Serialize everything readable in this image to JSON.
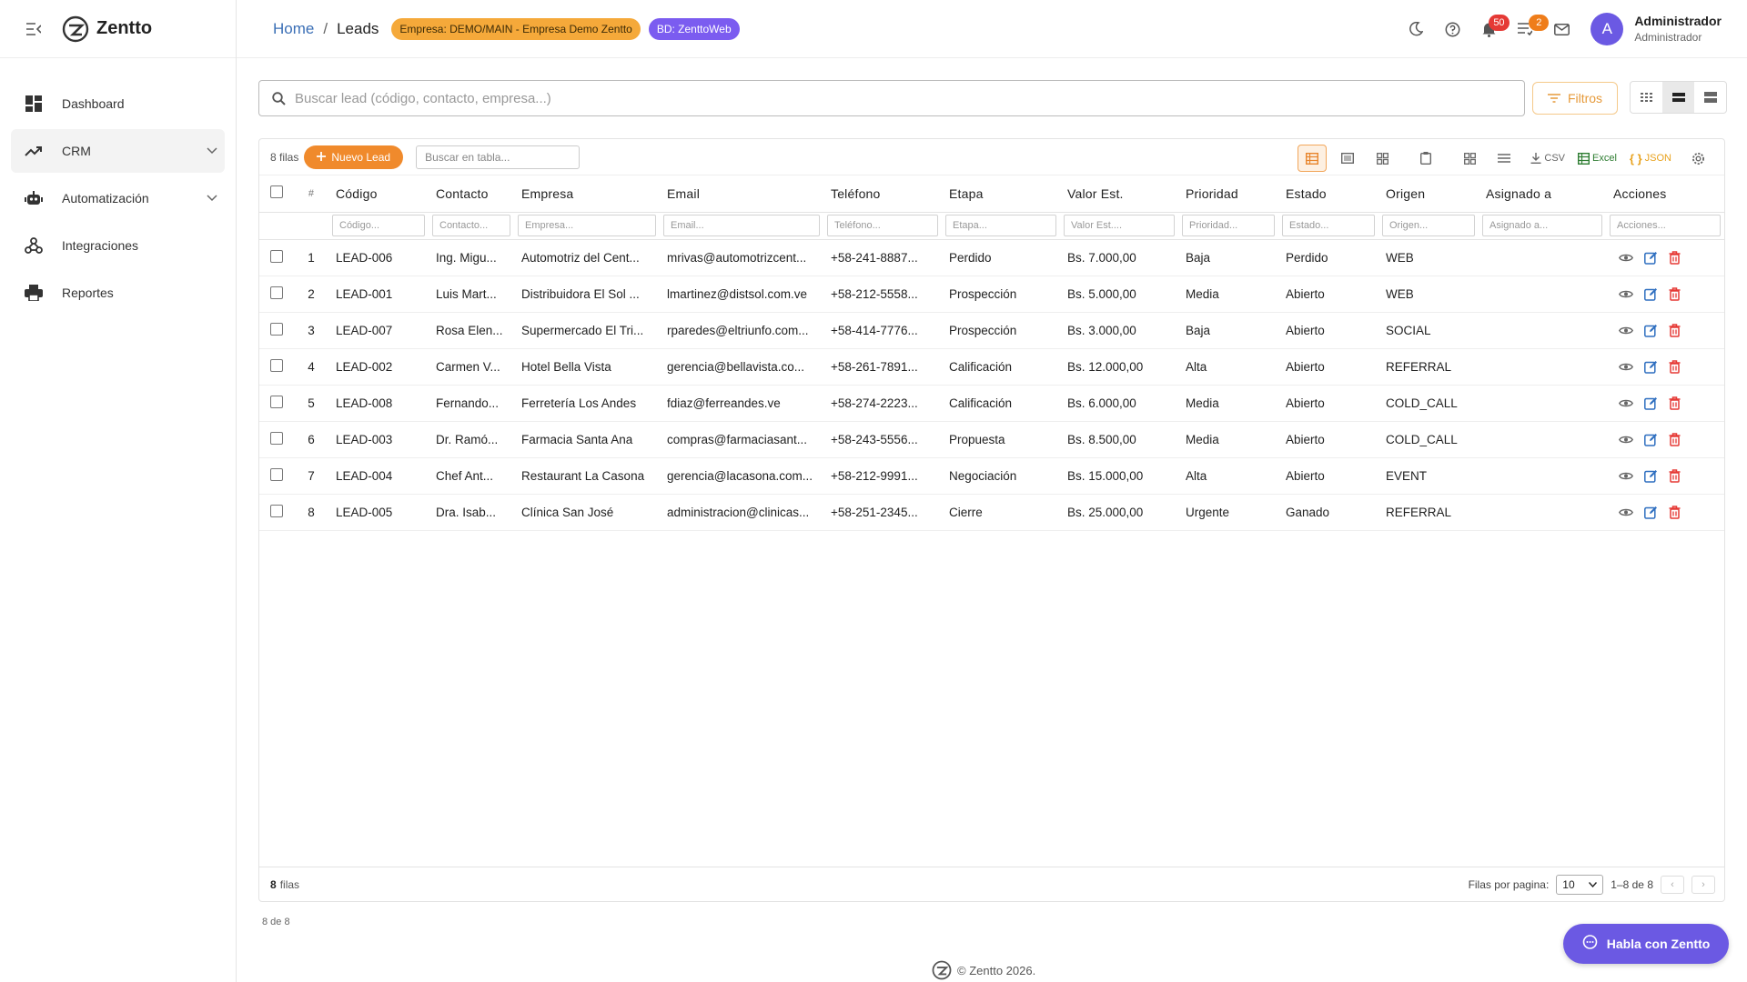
{
  "app": {
    "brand": "Zentto",
    "footer": "© Zentto 2026."
  },
  "sidebar": {
    "items": [
      {
        "label": "Dashboard",
        "icon": "dashboard-icon"
      },
      {
        "label": "CRM",
        "icon": "trending-up-icon",
        "active": true
      },
      {
        "label": "Automatización",
        "icon": "robot-icon"
      },
      {
        "label": "Integraciones",
        "icon": "webhook-icon"
      },
      {
        "label": "Reportes",
        "icon": "print-icon"
      }
    ]
  },
  "header": {
    "breadcrumb_home": "Home",
    "breadcrumb_sep": "/",
    "breadcrumb_current": "Leads",
    "company_badge": "Empresa: DEMO/MAIN - Empresa Demo Zentto",
    "db_badge": "BD: ZenttoWeb",
    "notifications_count": "50",
    "tasks_count": "2",
    "user_name": "Administrador",
    "user_role": "Administrador",
    "avatar_letter": "A"
  },
  "search": {
    "placeholder": "Buscar lead (código, contacto, empresa...)"
  },
  "filters_label": "Filtros",
  "grid": {
    "rows_label": "8 filas",
    "new_button": "Nuevo Lead",
    "table_search_placeholder": "Buscar en tabla...",
    "export_csv": "CSV",
    "export_excel": "Excel",
    "export_json": "JSON",
    "columns": [
      "#",
      "Código",
      "Contacto",
      "Empresa",
      "Email",
      "Teléfono",
      "Etapa",
      "Valor Est.",
      "Prioridad",
      "Estado",
      "Origen",
      "Asignado a",
      "Acciones"
    ],
    "filter_placeholders": [
      "Código...",
      "Contacto...",
      "Empresa...",
      "Email...",
      "Teléfono...",
      "Etapa...",
      "Valor Est....",
      "Prioridad...",
      "Estado...",
      "Origen...",
      "Asignado a...",
      "Acciones..."
    ],
    "rows": [
      [
        "1",
        "LEAD-006",
        "Ing. Migu...",
        "Automotriz del Cent...",
        "mrivas@automotrizcent...",
        "+58-241-8887...",
        "Perdido",
        "Bs. 7.000,00",
        "Baja",
        "Perdido",
        "WEB",
        ""
      ],
      [
        "2",
        "LEAD-001",
        "Luis Mart...",
        "Distribuidora El Sol ...",
        "lmartinez@distsol.com.ve",
        "+58-212-5558...",
        "Prospección",
        "Bs. 5.000,00",
        "Media",
        "Abierto",
        "WEB",
        ""
      ],
      [
        "3",
        "LEAD-007",
        "Rosa Elen...",
        "Supermercado El Tri...",
        "rparedes@eltriunfo.com...",
        "+58-414-7776...",
        "Prospección",
        "Bs. 3.000,00",
        "Baja",
        "Abierto",
        "SOCIAL",
        ""
      ],
      [
        "4",
        "LEAD-002",
        "Carmen V...",
        "Hotel Bella Vista",
        "gerencia@bellavista.co...",
        "+58-261-7891...",
        "Calificación",
        "Bs. 12.000,00",
        "Alta",
        "Abierto",
        "REFERRAL",
        ""
      ],
      [
        "5",
        "LEAD-008",
        "Fernando...",
        "Ferretería Los Andes",
        "fdiaz@ferreandes.ve",
        "+58-274-2223...",
        "Calificación",
        "Bs. 6.000,00",
        "Media",
        "Abierto",
        "COLD_CALL",
        ""
      ],
      [
        "6",
        "LEAD-003",
        "Dr. Ramó...",
        "Farmacia Santa Ana",
        "compras@farmaciasant...",
        "+58-243-5556...",
        "Propuesta",
        "Bs. 8.500,00",
        "Media",
        "Abierto",
        "COLD_CALL",
        ""
      ],
      [
        "7",
        "LEAD-004",
        "Chef Ant...",
        "Restaurant La Casona",
        "gerencia@lacasona.com...",
        "+58-212-9991...",
        "Negociación",
        "Bs. 15.000,00",
        "Alta",
        "Abierto",
        "EVENT",
        ""
      ],
      [
        "8",
        "LEAD-005",
        "Dra. Isab...",
        "Clínica San José",
        "administracion@clinicas...",
        "+58-251-2345...",
        "Cierre",
        "Bs. 25.000,00",
        "Urgente",
        "Ganado",
        "REFERRAL",
        ""
      ]
    ],
    "footer_count": "8",
    "footer_label": "filas",
    "rows_per_page_label": "Filas por pagina:",
    "rows_per_page_value": "10",
    "range_label": "1–8 de 8"
  },
  "below_grid_count": "8 de 8",
  "chat_button": "Habla con Zentto",
  "colors": {
    "accent": "#f08a2c",
    "brand_purple": "#6b59e3",
    "danger": "#e53935"
  }
}
